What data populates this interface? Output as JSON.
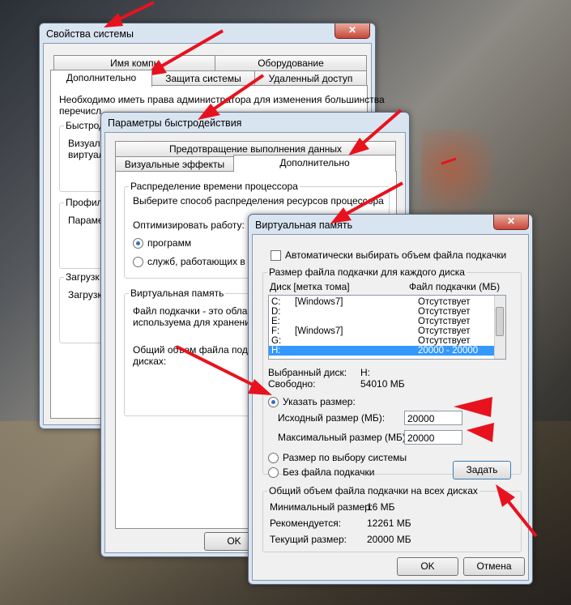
{
  "sys": {
    "title": "Свойства системы",
    "tabs_top": [
      "Имя компь",
      "Оборудование"
    ],
    "tabs_bottom": [
      "Дополнительно",
      "Защита системы",
      "Удаленный доступ"
    ],
    "admin_text_1": "Необходимо иметь права администратора для изменения большинства",
    "admin_text_2": "перечисл",
    "g1_cap": "Быстрод",
    "g1_line1": "Визуаль",
    "g1_line2": "виртуал",
    "g2_cap": "Профил",
    "g2_line1": "Парамет",
    "g3_cap": "Загрузк",
    "g3_line1": "Загрузк",
    "close": "✕"
  },
  "perf": {
    "title": "Параметры быстродействия",
    "tab_top": "Предотвращение выполнения данных",
    "tab_left": "Визуальные эффекты",
    "tab_right": "Дополнительно",
    "cpu_cap": "Распределение времени процессора",
    "cpu_desc": "Выберите способ распределения ресурсов процессора",
    "optimize": "Оптимизировать работу:",
    "opt1": "программ",
    "opt2": "служб, работающих в фо",
    "vm_cap": "Виртуальная память",
    "vm_desc1": "Файл подкачки - это област",
    "vm_desc2": "используема для хранения",
    "vm_total1": "Общий объем файла подкачк",
    "vm_total2": "дисках:",
    "ok": "OK"
  },
  "vm": {
    "title": "Виртуальная память",
    "close": "✕",
    "auto_label": "Автоматически выбирать объем файла подкачки",
    "group_cap": "Размер файла подкачки для каждого диска",
    "col_disk": "Диск [метка тома]",
    "col_file": "Файл подкачки (МБ)",
    "disks": [
      {
        "drive": "C:",
        "label": "[Windows7]",
        "size": "Отсутствует"
      },
      {
        "drive": "D:",
        "label": "",
        "size": "Отсутствует"
      },
      {
        "drive": "E:",
        "label": "",
        "size": "Отсутствует"
      },
      {
        "drive": "F:",
        "label": "[Windows7]",
        "size": "Отсутствует"
      },
      {
        "drive": "G:",
        "label": "",
        "size": "Отсутствует"
      },
      {
        "drive": "H:",
        "label": "",
        "size": "20000 - 20000"
      }
    ],
    "selected_disk_label": "Выбранный диск:",
    "selected_disk_value": "H:",
    "free_label": "Свободно:",
    "free_value": "54010 МБ",
    "custom_size": "Указать размер:",
    "initial_label": "Исходный размер (МБ):",
    "initial_value": "20000",
    "max_label": "Максимальный размер (МБ):",
    "max_value": "20000",
    "system_size": "Размер по выбору системы",
    "no_file": "Без файла подкачки",
    "set_btn": "Задать",
    "total_cap": "Общий объем файла подкачки на всех дисках",
    "min_label": "Минимальный размер:",
    "min_value": "16 МБ",
    "rec_label": "Рекомендуется:",
    "rec_value": "12261 МБ",
    "cur_label": "Текущий размер:",
    "cur_value": "20000 МБ",
    "ok": "OK",
    "cancel": "Отмена"
  },
  "colors": {
    "arrow": "#e8121e",
    "selection": "#3399ff"
  }
}
